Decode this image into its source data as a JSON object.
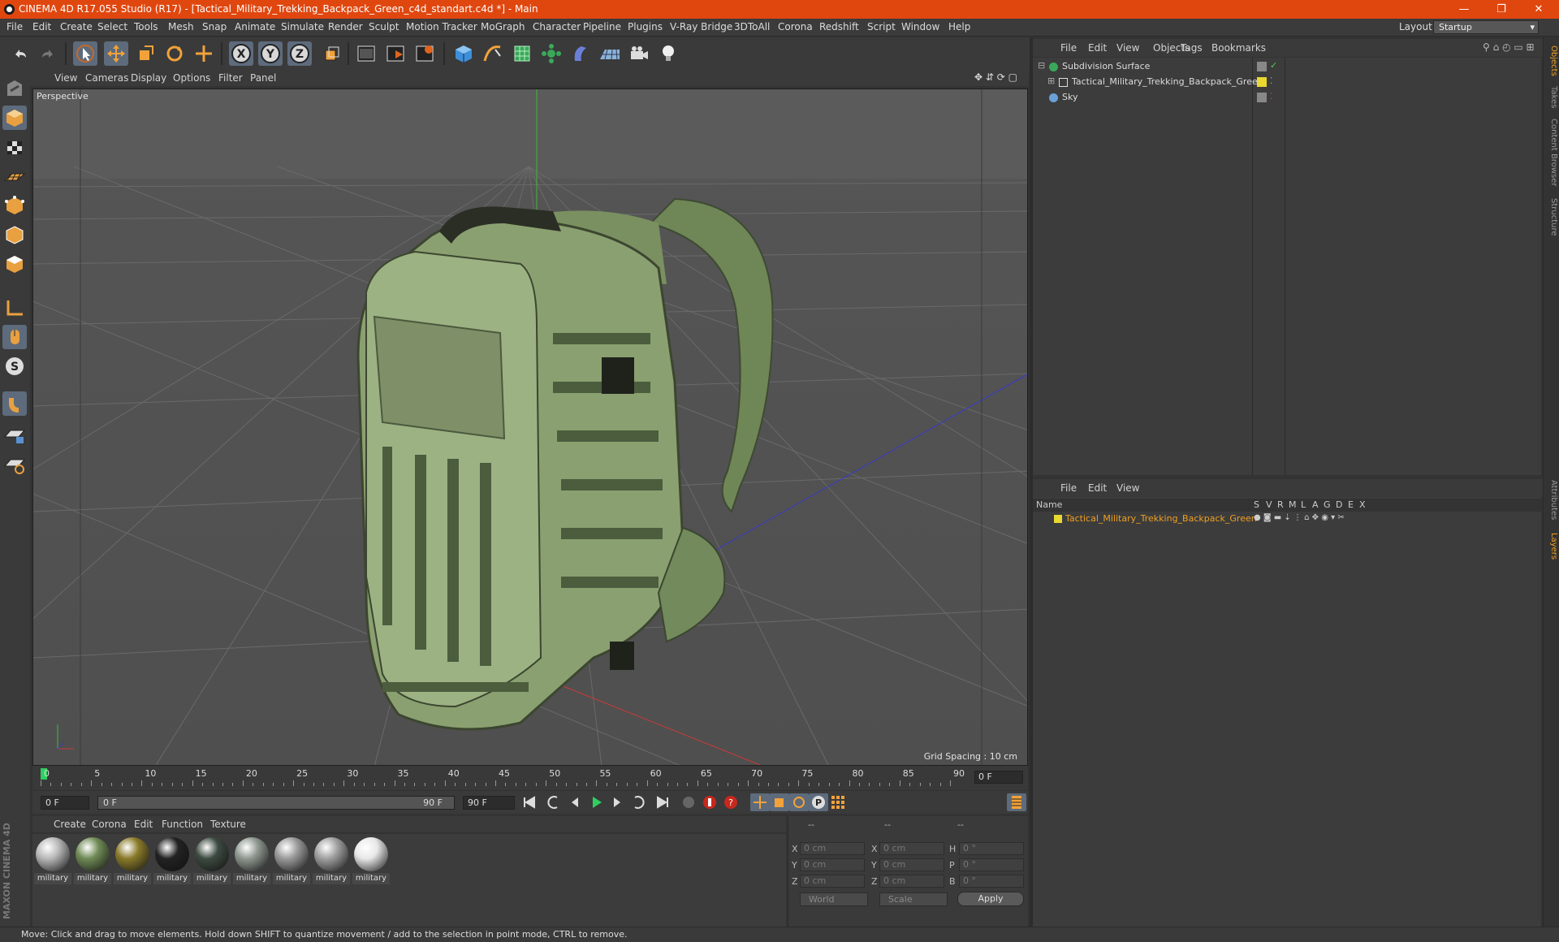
{
  "app": {
    "title": "CINEMA 4D R17.055 Studio (R17) - [Tactical_Military_Trekking_Backpack_Green_c4d_standart.c4d *] - Main",
    "window_controls": [
      "—",
      "❐",
      "✕"
    ]
  },
  "menubar": {
    "items": [
      "File",
      "Edit",
      "Create",
      "Select",
      "Tools",
      "Mesh",
      "Snap",
      "Animate",
      "Simulate",
      "Render",
      "Sculpt",
      "Motion Tracker",
      "MoGraph",
      "Character",
      "Pipeline",
      "Plugins",
      "V-Ray Bridge",
      "3DToAll",
      "Corona",
      "Redshift",
      "Script",
      "Window",
      "Help"
    ],
    "layout_label": "Layout:",
    "layout_value": "Startup"
  },
  "toolbar": {
    "icons": [
      "undo-icon",
      "redo-icon",
      "live-selection-icon",
      "move-icon",
      "scale-icon",
      "rotate-icon",
      "move-recent-icon",
      "x-axis-icon",
      "y-axis-icon",
      "z-axis-icon",
      "world-coordinates-icon",
      "render-view-icon",
      "render-picture-viewer-icon",
      "edit-render-settings-icon",
      "cube-icon",
      "pen-spline-icon",
      "subdivision-surface-icon",
      "array-icon",
      "deformer-icon",
      "floor-icon",
      "camera-icon",
      "light-icon"
    ],
    "axis_labels": [
      "X",
      "Y",
      "Z"
    ]
  },
  "viewport": {
    "menu": [
      "View",
      "Cameras",
      "Display",
      "Options",
      "Filter",
      "Panel"
    ],
    "label": "Perspective",
    "grid_spacing": "Grid Spacing : 10 cm"
  },
  "timeline": {
    "ticks": [
      "0",
      "5",
      "10",
      "15",
      "20",
      "25",
      "30",
      "35",
      "40",
      "45",
      "50",
      "55",
      "60",
      "65",
      "70",
      "75",
      "80",
      "85",
      "90"
    ],
    "current_frame": "0 F",
    "start_field": "0 F",
    "range_start": "0 F",
    "range_end": "90 F",
    "end_field": "90 F"
  },
  "materials": {
    "menu": [
      "Create",
      "Corona",
      "Edit",
      "Function",
      "Texture"
    ],
    "items": [
      {
        "label": "military",
        "color": "#b8b8b8"
      },
      {
        "label": "military",
        "color": "#6f8a55"
      },
      {
        "label": "military",
        "color": "#8a7a2a"
      },
      {
        "label": "military",
        "color": "#222222"
      },
      {
        "label": "military",
        "color": "#3c4a40"
      },
      {
        "label": "military",
        "color": "#8f9890"
      },
      {
        "label": "military",
        "color": "#9a9a9a"
      },
      {
        "label": "military",
        "color": "#a0a0a0"
      },
      {
        "label": "military",
        "color": "#e8e8e8"
      }
    ]
  },
  "coords": {
    "header": [
      "--",
      "--",
      "--"
    ],
    "rows": [
      {
        "a": "X",
        "av": "0 cm",
        "b": "X",
        "bv": "0 cm",
        "c": "H",
        "cv": "0 °"
      },
      {
        "a": "Y",
        "av": "0 cm",
        "b": "Y",
        "bv": "0 cm",
        "c": "P",
        "cv": "0 °"
      },
      {
        "a": "Z",
        "av": "0 cm",
        "b": "Z",
        "bv": "0 cm",
        "c": "B",
        "cv": "0 °"
      }
    ],
    "mode1": "World",
    "mode2": "Scale",
    "apply": "Apply"
  },
  "objects": {
    "menu": [
      "File",
      "Edit",
      "View",
      "Objects",
      "Tags",
      "Bookmarks"
    ],
    "items": [
      {
        "name": "Subdivision Surface",
        "color": "#7bd07b"
      },
      {
        "name": "Tactical_Military_Trekking_Backpack_Green",
        "color": "#e8d830"
      },
      {
        "name": "Sky",
        "color": "#6aa0d8"
      }
    ]
  },
  "layers": {
    "menu": [
      "File",
      "Edit",
      "View"
    ],
    "header_name": "Name",
    "columns": [
      "S",
      "V",
      "R",
      "M",
      "L",
      "A",
      "G",
      "D",
      "E",
      "X"
    ],
    "row_name": "Tactical_Military_Trekking_Backpack_Green",
    "row_color": "#f0a020"
  },
  "right_tabs": [
    "Objects",
    "Takes",
    "Content Browser",
    "Structure",
    "Attributes",
    "Layers"
  ],
  "status": "Move: Click and drag to move elements. Hold down SHIFT to quantize movement / add to the selection in point mode, CTRL to remove.",
  "brand": "MAXON CINEMA 4D",
  "colors": {
    "accent": "#e0470f",
    "selection": "#5d6b7c",
    "object_highlight": "#f0a020"
  }
}
